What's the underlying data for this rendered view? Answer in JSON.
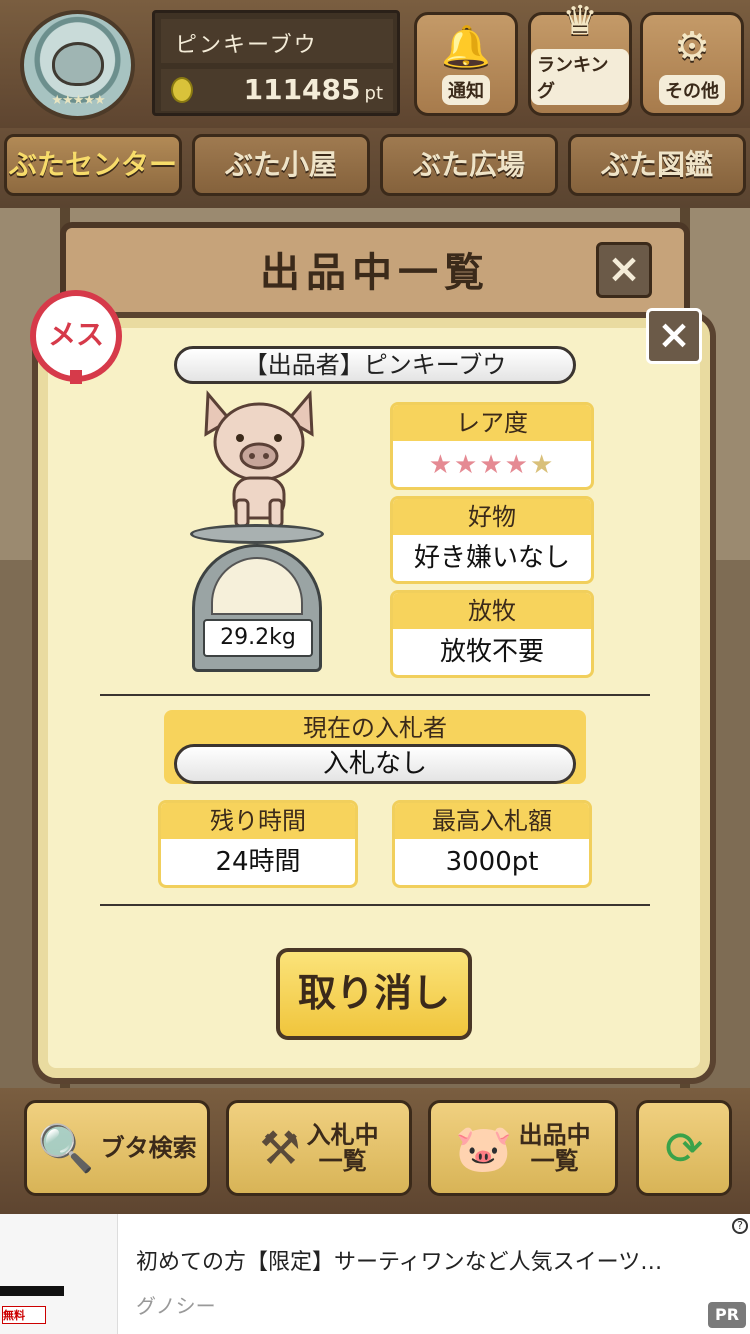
{
  "user": {
    "name": "ピンキーブウ",
    "points": "111485",
    "points_unit": "pt"
  },
  "top_buttons": [
    {
      "label": "通知",
      "icon": "bell-icon"
    },
    {
      "label": "ランキング",
      "icon": "crown-icon"
    },
    {
      "label": "その他",
      "icon": "gear-icon"
    }
  ],
  "tabs": [
    {
      "label": "ぶたセンター",
      "active": true
    },
    {
      "label": "ぶた小屋",
      "active": false
    },
    {
      "label": "ぶた広場",
      "active": false
    },
    {
      "label": "ぶた図鑑",
      "active": false
    }
  ],
  "dialog": {
    "title": "出品中一覧",
    "gender": "メス",
    "seller": "【出品者】ピンキーブウ",
    "weight": "29.2kg",
    "rarity": {
      "label": "レア度",
      "filled": 4,
      "total": 5
    },
    "favorite": {
      "label": "好物",
      "value": "好き嫌いなし"
    },
    "grazing": {
      "label": "放牧",
      "value": "放牧不要"
    },
    "current_bidder": {
      "label": "現在の入札者",
      "value": "入札なし"
    },
    "remaining_time": {
      "label": "残り時間",
      "value": "24時間"
    },
    "max_bid": {
      "label": "最高入札額",
      "value": "3000pt"
    },
    "cancel_label": "取り消し"
  },
  "bottom_buttons": [
    {
      "label_line1": "ブタ検索",
      "label_line2": "",
      "icon": "magnifier-icon"
    },
    {
      "label_line1": "入札中",
      "label_line2": "一覧",
      "icon": "gavel-icon"
    },
    {
      "label_line1": "出品中",
      "label_line2": "一覧",
      "icon": "pig-icon"
    },
    {
      "label_line1": "",
      "label_line2": "",
      "icon": "refresh-icon"
    }
  ],
  "ad": {
    "title": "初めての方【限定】サーティワンなど人気スイーツ…",
    "source": "グノシー",
    "pr_label": "PR",
    "thumb_badge": "無料"
  },
  "colors": {
    "accent_yellow": "#f7d35c",
    "star_filled": "#e58a93",
    "gender_red": "#d63a4a"
  }
}
